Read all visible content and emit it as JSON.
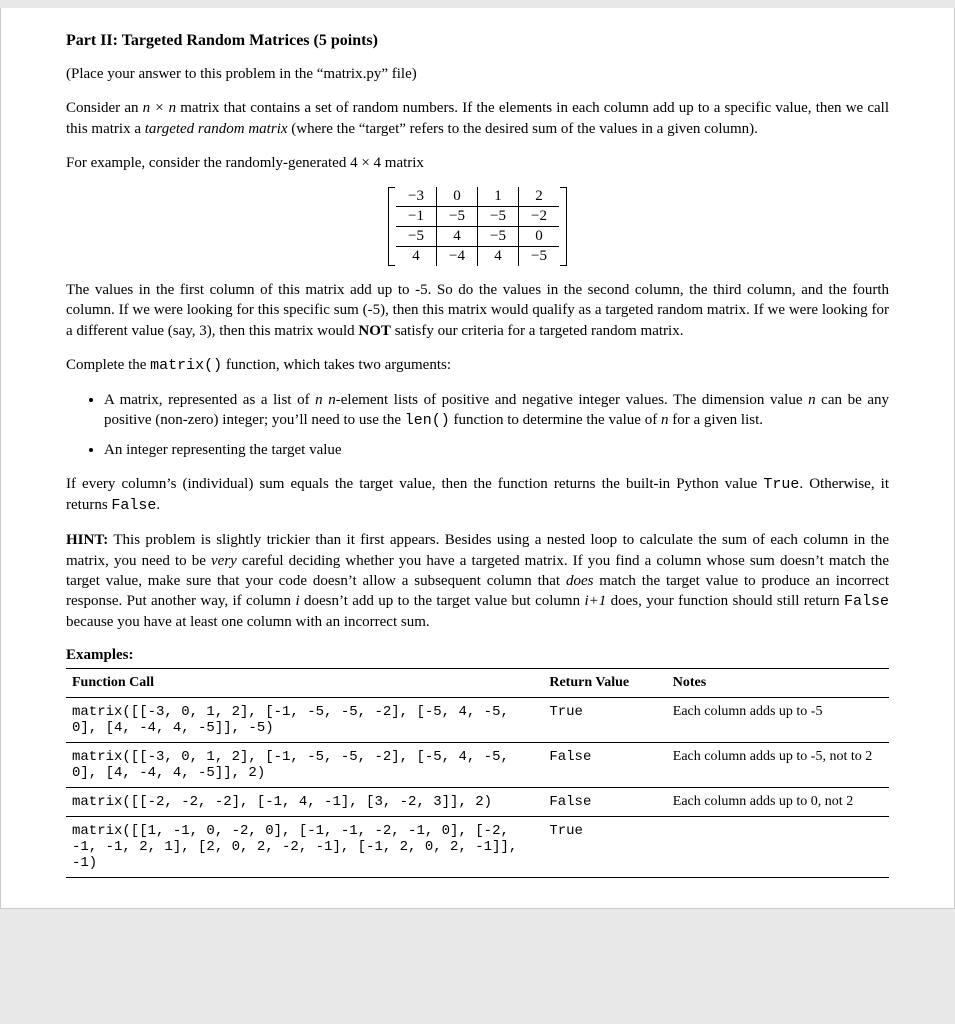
{
  "title": "Part II: Targeted Random Matrices (5 points)",
  "placeNote": "(Place your answer to this problem in the “matrix.py” file)",
  "para1_a": "Consider an ",
  "para1_dim": "n × n",
  "para1_b": " matrix that contains a set of random numbers. If the elements in each column add up to a specific value, then we call this matrix a ",
  "para1_term": "targeted random matrix",
  "para1_c": " (where the “target” refers to the desired sum of the values in a given column).",
  "para2": "For example, consider the randomly-generated 4 × 4 matrix",
  "matrix": [
    [
      "−3",
      "0",
      "1",
      "2"
    ],
    [
      "−1",
      "−5",
      "−5",
      "−2"
    ],
    [
      "−5",
      "4",
      "−5",
      "0"
    ],
    [
      "4",
      "−4",
      "4",
      "−5"
    ]
  ],
  "para3_a": "The values in the first column of this matrix add up to -5. So do the values in the second column, the third column, and the fourth column. If we were looking for this specific sum (-5), then this matrix would qualify as a targeted random matrix. If we were looking for a different value (say, 3), then this matrix would ",
  "para3_not": "NOT",
  "para3_b": " satisfy our criteria for a targeted random matrix.",
  "para4_a": "Complete the ",
  "para4_fn": "matrix()",
  "para4_b": " function, which takes two arguments:",
  "bullet1_a": "A matrix, represented as a list of ",
  "bullet1_dim": "n n",
  "bullet1_b": "-element lists of positive and negative integer values. The dimension value ",
  "bullet1_n": "n",
  "bullet1_c": " can be any positive (non-zero) integer; you’ll need to use the ",
  "bullet1_len": "len()",
  "bullet1_d": " function to determine the value of ",
  "bullet1_n2": "n",
  "bullet1_e": " for a given list.",
  "bullet2": "An integer representing the target value",
  "para5_a": "If every column’s (individual) sum equals the target value, then the function returns the built-in Python value ",
  "para5_true": "True",
  "para5_b": ". Otherwise, it returns ",
  "para5_false": "False",
  "para5_c": ".",
  "hint_label": "HINT:",
  "hint_a": " This problem is slightly trickier than it first appears. Besides using a nested loop to calculate the sum of each column in the matrix, you need to be ",
  "hint_very": "very",
  "hint_b": " careful deciding whether you have a targeted matrix. If you find a column whose sum doesn’t match the target value, make sure that your code doesn’t allow a subsequent column that ",
  "hint_does": "does",
  "hint_c": " match the target value to produce an incorrect response. Put another way, if column ",
  "hint_i": "i",
  "hint_d": " doesn’t add up to the target value but column ",
  "hint_i1": "i+1",
  "hint_e": " does, your function should still return ",
  "hint_false": "False",
  "hint_f": " because you have at least one column with an incorrect sum.",
  "examples_label": "Examples:",
  "table": {
    "headers": [
      "Function Call",
      "Return Value",
      "Notes"
    ],
    "rows": [
      {
        "call": "matrix([[-3, 0, 1, 2], [-1, -5, -5, -2], [-5, 4, -5, 0], [4, -4, 4, -5]], -5)",
        "ret": "True",
        "notes": "Each column adds up to -5"
      },
      {
        "call": "matrix([[-3, 0, 1, 2], [-1, -5, -5, -2], [-5, 4, -5, 0], [4, -4, 4, -5]], 2)",
        "ret": "False",
        "notes": "Each column adds up to -5, not to 2"
      },
      {
        "call": "matrix([[-2, -2, -2], [-1, 4, -1], [3, -2, 3]], 2)",
        "ret": "False",
        "notes": "Each column adds up to 0, not 2"
      },
      {
        "call": "matrix([[1, -1, 0, -2, 0], [-1, -1, -2, -1, 0], [-2, -1, -1, 2, 1], [2, 0, 2, -2, -1], [-1, 2, 0, 2, -1]], -1)",
        "ret": "True",
        "notes": ""
      }
    ]
  }
}
